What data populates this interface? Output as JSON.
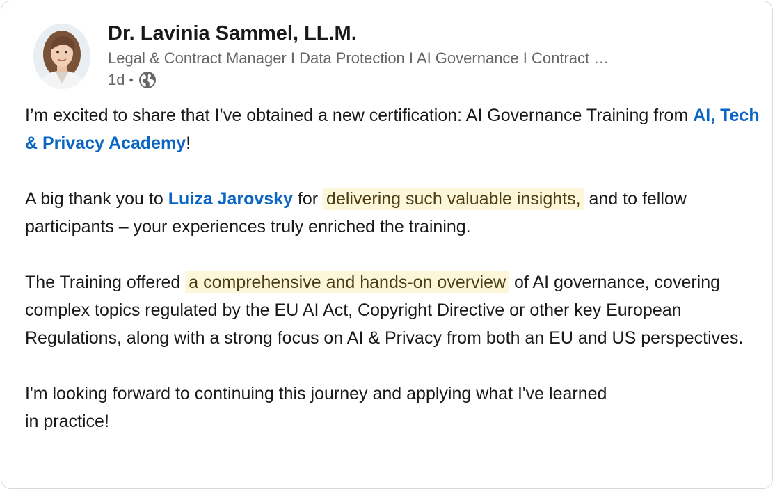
{
  "author": {
    "name": "Dr. Lavinia Sammel, LL.M.",
    "headline": "Legal & Contract Manager I Data Protection I AI Governance I Contract …",
    "timestamp": "1d",
    "separator": "•",
    "visibility_icon": "globe-icon"
  },
  "post": {
    "p1_a": "I’m excited to share that I’ve obtained a new certification: AI Governance Training from ",
    "p1_mention": "AI, Tech & Privacy Academy",
    "p1_b": "!",
    "p2_a": "A big thank you to ",
    "p2_mention": "Luiza Jarovsky",
    "p2_b": " for ",
    "p2_highlight": "delivering such valuable insights,",
    "p2_c": " and to fellow participants – your experiences truly enriched the training.",
    "p3_a": "The Training offered ",
    "p3_highlight": "a comprehensive and hands-on overview",
    "p3_b": " of AI governance, covering complex topics regulated by the EU AI Act, Copyright Directive or other key European Regulations, along with a strong focus on AI & Privacy from both an EU and US perspectives.",
    "p4_line1": "I'm looking forward to continuing this journey and applying what I've learned",
    "p4_line2": "in practice!"
  },
  "colors": {
    "link": "#0a66c2",
    "highlight_bg": "#fdf7da",
    "text": "#191919",
    "muted": "#666666"
  }
}
